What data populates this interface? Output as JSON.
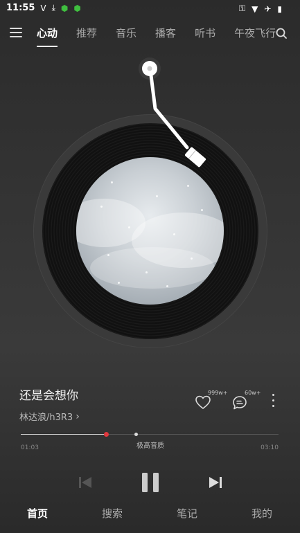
{
  "status_bar": {
    "time": "11:55",
    "left_icons": [
      "v-icon",
      "download-icon",
      "app-icon",
      "app-icon"
    ],
    "right_icons": [
      "key-icon",
      "wifi-icon",
      "airplane-icon",
      "battery-icon"
    ]
  },
  "top_nav": {
    "tabs": [
      {
        "label": "心动",
        "active": true
      },
      {
        "label": "推荐",
        "active": false
      },
      {
        "label": "音乐",
        "active": false
      },
      {
        "label": "播客",
        "active": false
      },
      {
        "label": "听书",
        "active": false
      },
      {
        "label": "午夜飞行",
        "active": false
      }
    ]
  },
  "song": {
    "title": "还是会想你",
    "artist": "林达浪/h3R3",
    "artist_chevron": "›"
  },
  "actions": {
    "like_count": "999w+",
    "comment_count": "60w+"
  },
  "progress": {
    "current": "01:03",
    "total": "03:10",
    "quality_label": "极高音质",
    "played_fraction": 0.331,
    "buffered_fraction": 0.446
  },
  "bottom_nav": {
    "items": [
      {
        "label": "首页",
        "active": true
      },
      {
        "label": "搜索",
        "active": false
      },
      {
        "label": "笔记",
        "active": false
      },
      {
        "label": "我的",
        "active": false
      }
    ]
  },
  "colors": {
    "accent": "#e0383e",
    "background": "#333333"
  }
}
